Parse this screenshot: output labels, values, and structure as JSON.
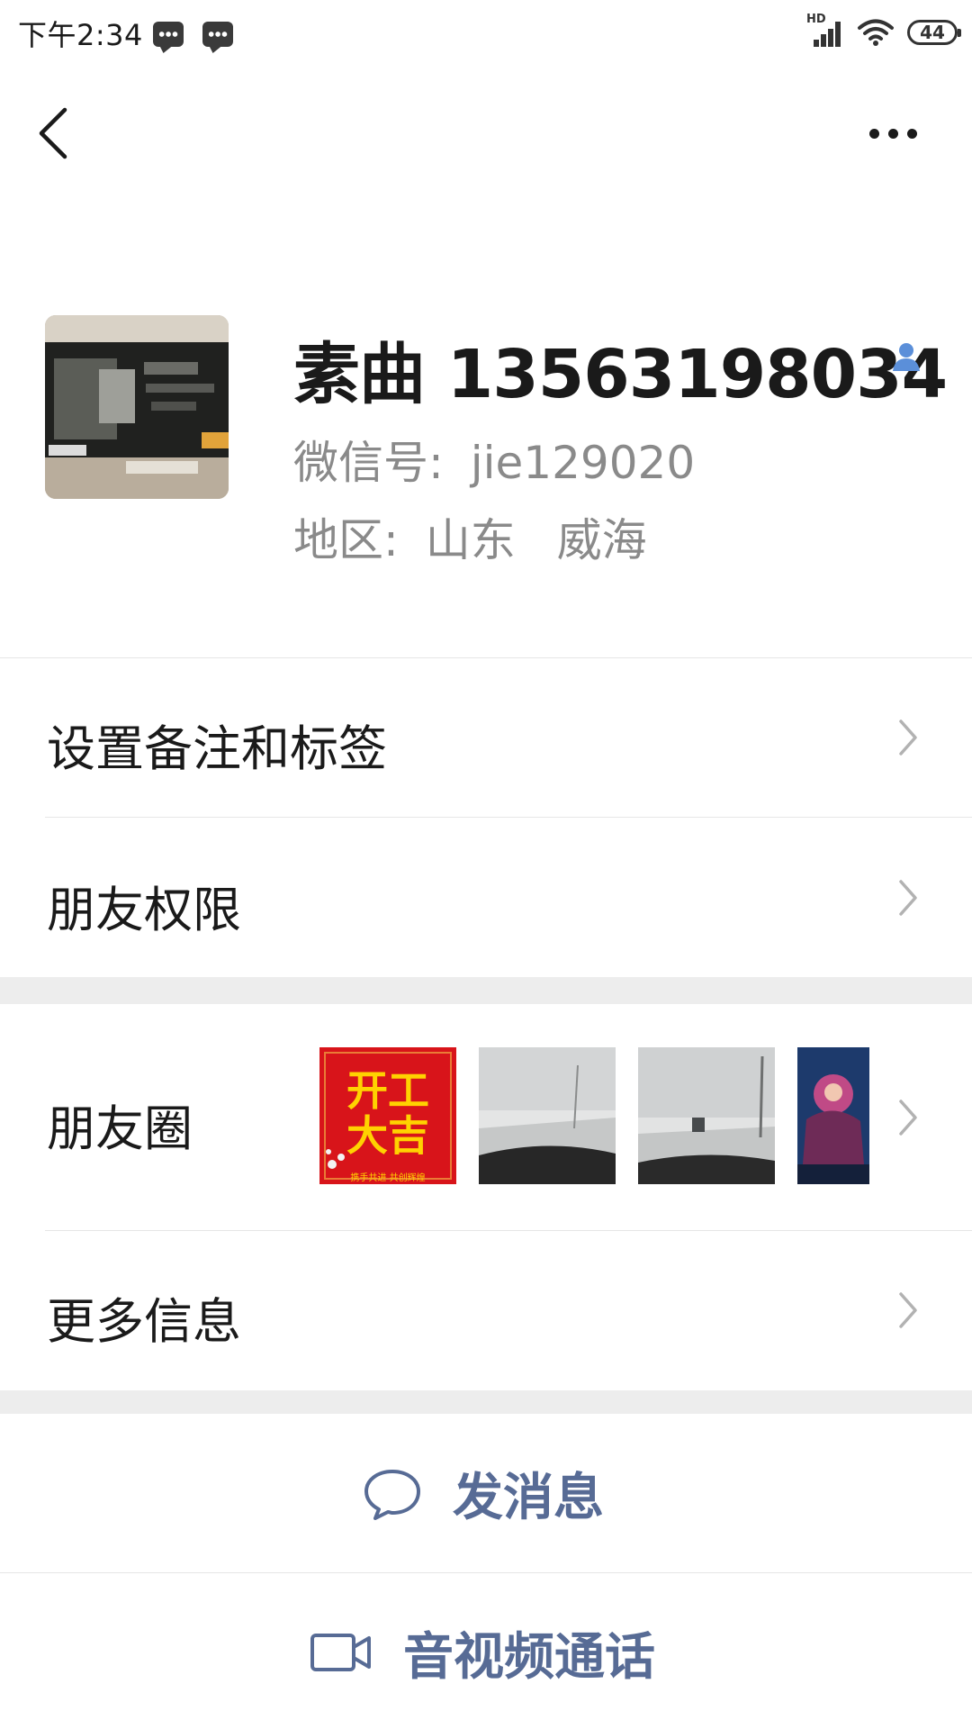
{
  "status_bar": {
    "time": "下午2:34",
    "network": "HD",
    "battery": "44",
    "icons": [
      "message-icon",
      "message-icon",
      "signal-icon",
      "wifi-icon",
      "battery-icon"
    ]
  },
  "nav": {
    "back_icon": "back-chevron-icon",
    "more_icon": "more-dots-icon"
  },
  "profile": {
    "name": "素曲 13563198034",
    "wechat_id_label": "微信号:",
    "wechat_id": "jie129020",
    "region_label": "地区:",
    "region_province": "山东",
    "region_city": "威海",
    "badge_icon": "person-badge-icon"
  },
  "menu": {
    "remark_tags": "设置备注和标签",
    "friend_permissions": "朋友权限",
    "moments": "朋友圈",
    "more_info": "更多信息"
  },
  "moments_thumbs": {
    "first_text_top": "开工",
    "first_text_bottom": "大吉",
    "first_caption": "携手共进 共创辉煌"
  },
  "actions": {
    "send_message": "发消息",
    "video_call": "音视频通话"
  },
  "colors": {
    "link_blue": "#576b95",
    "badge_blue": "#5b8fd9",
    "separator": "#ededed",
    "secondary_text": "#8a8a8a"
  }
}
